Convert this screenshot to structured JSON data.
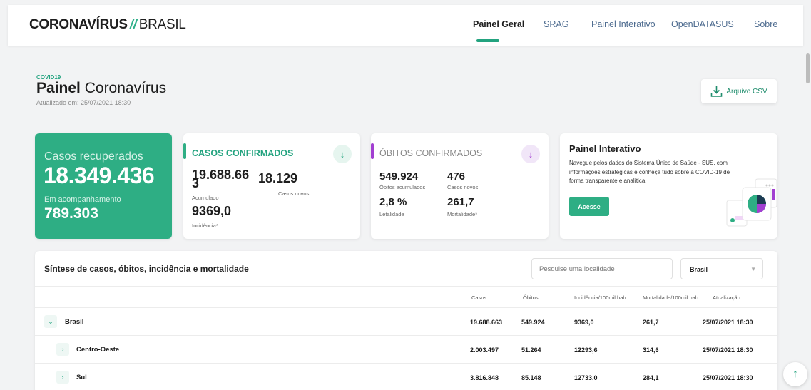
{
  "header": {
    "logo_bold": "CORONAVÍRUS",
    "logo_slash": "//",
    "logo_light": "BRASIL",
    "nav": [
      "Painel Geral",
      "SRAG",
      "Painel Interativo",
      "OpenDATASUS",
      "Sobre"
    ]
  },
  "page": {
    "tag": "COVID19",
    "title_bold": "Painel",
    "title_rest": "Coronavírus",
    "updated": "Atualizado em: 25/07/2021 18:30",
    "csv_label": "Arquivo CSV"
  },
  "recovered": {
    "label": "Casos recuperados",
    "value": "18.349.436",
    "label2": "Em acompanhamento",
    "value2": "789.303"
  },
  "confirmed": {
    "title": "CASOS CONFIRMADOS",
    "accumulated_line1": "19.688.66",
    "accumulated_line2": "3",
    "accumulated_label": "Acumulado",
    "new": "18.129",
    "new_label": "Casos novos",
    "incidence": "9369,0",
    "incidence_label": "Incidência*",
    "color": "#2eae84"
  },
  "deaths": {
    "title": "ÓBITOS CONFIRMADOS",
    "accumulated": "549.924",
    "accumulated_label": "Óbitos acumulados",
    "new": "476",
    "new_label": "Casos novos",
    "lethality": "2,8 %",
    "lethality_label": "Letalidade",
    "mortality": "261,7",
    "mortality_label": "Mortalidade*",
    "color": "#a23fd1"
  },
  "interactive": {
    "title": "Painel Interativo",
    "description": "Navegue pelos dados do Sistema Único de Saúde - SUS, com informações estratégicas e conheça tudo sobre a COVID-19 de forma transparente e analítica.",
    "button": "Acesse"
  },
  "table": {
    "title": "Síntese de casos, óbitos, incidência e mortalidade",
    "search_placeholder": "Pesquise uma localidade",
    "select_value": "Brasil",
    "headers": [
      "Casos",
      "Óbitos",
      "Incidência/100mil hab.",
      "Mortalidade/100mil hab",
      "Atualização"
    ],
    "rows": [
      {
        "name": "Brasil",
        "expanded": true,
        "cases": "19.688.663",
        "deaths": "549.924",
        "incidence": "9369,0",
        "mortality": "261,7",
        "updated": "25/07/2021 18:30"
      },
      {
        "name": "Centro-Oeste",
        "expanded": false,
        "cases": "2.003.497",
        "deaths": "51.264",
        "incidence": "12293,6",
        "mortality": "314,6",
        "updated": "25/07/2021 18:30"
      },
      {
        "name": "Sul",
        "expanded": false,
        "cases": "3.816.848",
        "deaths": "85.148",
        "incidence": "12733,0",
        "mortality": "284,1",
        "updated": "25/07/2021 18:30"
      }
    ]
  },
  "colors": {
    "accent": "#2eae84",
    "purple": "#a23fd1",
    "link": "#4d6b8f"
  }
}
